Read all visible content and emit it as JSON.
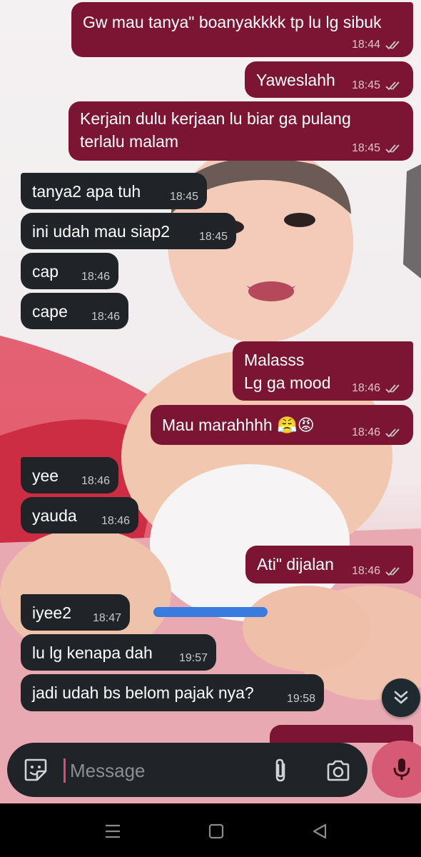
{
  "chat": {
    "messages": [
      {
        "dir": "out",
        "text": "Gw mau tanya\" boanyakkkk tp lu lg sibuk",
        "time": "18:44"
      },
      {
        "dir": "out",
        "text": "Yaweslahh",
        "time": "18:45"
      },
      {
        "dir": "out",
        "text": "Kerjain dulu kerjaan lu biar ga pulang\nterlalu malam",
        "time": "18:45"
      },
      {
        "dir": "in",
        "text": "tanya2 apa tuh",
        "time": "18:45"
      },
      {
        "dir": "in",
        "text": "ini udah mau siap2",
        "time": "18:45"
      },
      {
        "dir": "in",
        "text": "cap",
        "time": "18:46"
      },
      {
        "dir": "in",
        "text": "cape",
        "time": "18:46"
      },
      {
        "dir": "out",
        "text": "Malasss\nLg ga mood",
        "time": "18:46"
      },
      {
        "dir": "out",
        "text": "Mau marahhhh 😤😡",
        "time": "18:46"
      },
      {
        "dir": "in",
        "text": "yee",
        "time": "18:46"
      },
      {
        "dir": "in",
        "text": "yauda",
        "time": "18:46"
      },
      {
        "dir": "out",
        "text": "Ati\" dijalan",
        "time": "18:46"
      },
      {
        "dir": "in",
        "text": "iyee2",
        "time": "18:47"
      },
      {
        "dir": "in",
        "text": "lu lg kenapa dah",
        "time": "19:57"
      },
      {
        "dir": "in",
        "text": "jadi udah bs belom pajak nya?",
        "time": "19:58"
      }
    ]
  },
  "input": {
    "placeholder": "Message",
    "value": ""
  },
  "icons": {
    "emoji": "sticker-emoji-icon",
    "attach": "paperclip-icon",
    "camera": "camera-icon",
    "mic": "microphone-icon",
    "scroll_down": "double-chevron-down-icon",
    "nav_recents": "menu-lines-icon",
    "nav_home": "square-icon",
    "nav_back": "triangle-back-icon"
  },
  "colors": {
    "outgoing_bubble": "#7b1533",
    "incoming_bubble": "#202428",
    "mic_button": "#d75a74",
    "read_ticks": "#c9cdd1"
  }
}
